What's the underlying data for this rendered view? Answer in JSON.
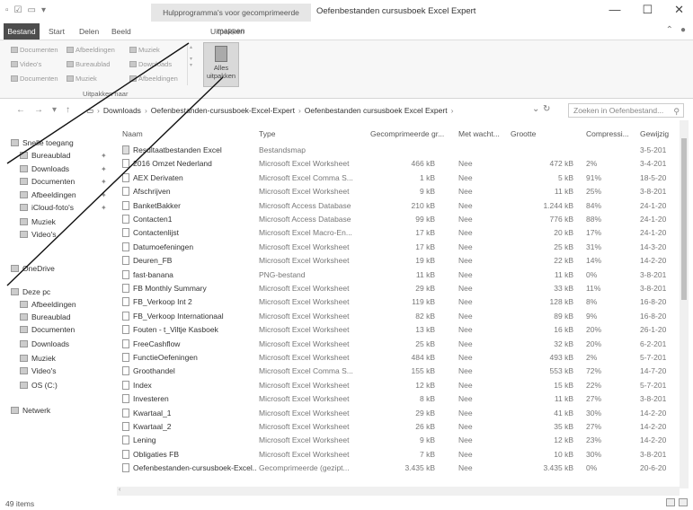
{
  "window": {
    "context_tab": "Hulpprogramma's voor gecomprimeerde mappen",
    "title": "Oefenbestanden cursusboek Excel Expert",
    "minimize": "—",
    "maximize": "☐",
    "close": "✕"
  },
  "ribbon": {
    "tabs": [
      "Bestand",
      "Start",
      "Delen",
      "Beeld",
      "Uitpakken"
    ],
    "gallery": [
      "Documenten",
      "Afbeeldingen",
      "Muziek",
      "Video's",
      "Bureaublad",
      "Downloads",
      "Documenten",
      "Muziek",
      "Afbeeldingen"
    ],
    "extract_all": "Alles uitpakken",
    "group_label": "Uitpakken naar"
  },
  "address": {
    "path": [
      "Downloads",
      "Oefenbestanden-cursusboek-Excel-Expert",
      "Oefenbestanden cursusboek Excel Expert"
    ],
    "search_placeholder": "Zoeken in Oefenbestand..."
  },
  "navpane": [
    {
      "label": "Snelle toegang",
      "icon": "star-icon",
      "pinned": false,
      "indent": 0
    },
    {
      "label": "Bureaublad",
      "icon": "desktop-icon",
      "pinned": true,
      "indent": 1
    },
    {
      "label": "Downloads",
      "icon": "download-icon",
      "pinned": true,
      "indent": 1
    },
    {
      "label": "Documenten",
      "icon": "document-icon",
      "pinned": true,
      "indent": 1
    },
    {
      "label": "Afbeeldingen",
      "icon": "picture-icon",
      "pinned": true,
      "indent": 1
    },
    {
      "label": "iCloud-foto's",
      "icon": "cloud-icon",
      "pinned": true,
      "indent": 1
    },
    {
      "label": "Muziek",
      "icon": "music-icon",
      "pinned": false,
      "indent": 1
    },
    {
      "label": "Video's",
      "icon": "video-icon",
      "pinned": false,
      "indent": 1
    },
    {
      "label": "OneDrive",
      "icon": "onedrive-icon",
      "pinned": false,
      "indent": 0
    },
    {
      "label": "Deze pc",
      "icon": "computer-icon",
      "pinned": false,
      "indent": 0
    },
    {
      "label": "Afbeeldingen",
      "icon": "picture-icon",
      "pinned": false,
      "indent": 1
    },
    {
      "label": "Bureaublad",
      "icon": "desktop-icon",
      "pinned": false,
      "indent": 1
    },
    {
      "label": "Documenten",
      "icon": "document-icon",
      "pinned": false,
      "indent": 1
    },
    {
      "label": "Downloads",
      "icon": "download-icon",
      "pinned": false,
      "indent": 1
    },
    {
      "label": "Muziek",
      "icon": "music-icon",
      "pinned": false,
      "indent": 1
    },
    {
      "label": "Video's",
      "icon": "video-icon",
      "pinned": false,
      "indent": 1
    },
    {
      "label": "OS (C:)",
      "icon": "drive-icon",
      "pinned": false,
      "indent": 1
    },
    {
      "label": "Netwerk",
      "icon": "network-icon",
      "pinned": false,
      "indent": 0
    }
  ],
  "columns": [
    "Naam",
    "Type",
    "Gecomprimeerde gr...",
    "Met wacht...",
    "Grootte",
    "Compressi...",
    "Gewijzig"
  ],
  "files": [
    [
      "Resultaatbestanden Excel",
      "Bestandsmap",
      "",
      "",
      "",
      "",
      "3-5-201"
    ],
    [
      "2016 Omzet Nederland",
      "Microsoft Excel Worksheet",
      "466 kB",
      "Nee",
      "472 kB",
      "2%",
      "3-4-201"
    ],
    [
      "AEX Derivaten",
      "Microsoft Excel Comma S...",
      "1 kB",
      "Nee",
      "5 kB",
      "91%",
      "18-5-20"
    ],
    [
      "Afschrijven",
      "Microsoft Excel Worksheet",
      "9 kB",
      "Nee",
      "11 kB",
      "25%",
      "3-8-201"
    ],
    [
      "BanketBakker",
      "Microsoft Access Database",
      "210 kB",
      "Nee",
      "1.244 kB",
      "84%",
      "24-1-20"
    ],
    [
      "Contacten1",
      "Microsoft Access Database",
      "99 kB",
      "Nee",
      "776 kB",
      "88%",
      "24-1-20"
    ],
    [
      "Contactenlijst",
      "Microsoft Excel Macro-En...",
      "17 kB",
      "Nee",
      "20 kB",
      "17%",
      "24-1-20"
    ],
    [
      "Datumoefeningen",
      "Microsoft Excel Worksheet",
      "17 kB",
      "Nee",
      "25 kB",
      "31%",
      "14-3-20"
    ],
    [
      "Deuren_FB",
      "Microsoft Excel Worksheet",
      "19 kB",
      "Nee",
      "22 kB",
      "14%",
      "14-2-20"
    ],
    [
      "fast-banana",
      "PNG-bestand",
      "11 kB",
      "Nee",
      "11 kB",
      "0%",
      "3-8-201"
    ],
    [
      "FB Monthly Summary",
      "Microsoft Excel Worksheet",
      "29 kB",
      "Nee",
      "33 kB",
      "11%",
      "3-8-201"
    ],
    [
      "FB_Verkoop Int 2",
      "Microsoft Excel Worksheet",
      "119 kB",
      "Nee",
      "128 kB",
      "8%",
      "16-8-20"
    ],
    [
      "FB_Verkoop Internationaal",
      "Microsoft Excel Worksheet",
      "82 kB",
      "Nee",
      "89 kB",
      "9%",
      "16-8-20"
    ],
    [
      "Fouten - t_Viltje Kasboek",
      "Microsoft Excel Worksheet",
      "13 kB",
      "Nee",
      "16 kB",
      "20%",
      "26-1-20"
    ],
    [
      "FreeCashflow",
      "Microsoft Excel Worksheet",
      "25 kB",
      "Nee",
      "32 kB",
      "20%",
      "6-2-201"
    ],
    [
      "FunctieOefeningen",
      "Microsoft Excel Worksheet",
      "484 kB",
      "Nee",
      "493 kB",
      "2%",
      "5-7-201"
    ],
    [
      "Groothandel",
      "Microsoft Excel Comma S...",
      "155 kB",
      "Nee",
      "553 kB",
      "72%",
      "14-7-20"
    ],
    [
      "Index",
      "Microsoft Excel Worksheet",
      "12 kB",
      "Nee",
      "15 kB",
      "22%",
      "5-7-201"
    ],
    [
      "Investeren",
      "Microsoft Excel Worksheet",
      "8 kB",
      "Nee",
      "11 kB",
      "27%",
      "3-8-201"
    ],
    [
      "Kwartaal_1",
      "Microsoft Excel Worksheet",
      "29 kB",
      "Nee",
      "41 kB",
      "30%",
      "14-2-20"
    ],
    [
      "Kwartaal_2",
      "Microsoft Excel Worksheet",
      "26 kB",
      "Nee",
      "35 kB",
      "27%",
      "14-2-20"
    ],
    [
      "Lening",
      "Microsoft Excel Worksheet",
      "9 kB",
      "Nee",
      "12 kB",
      "23%",
      "14-2-20"
    ],
    [
      "Obligaties FB",
      "Microsoft Excel Worksheet",
      "7 kB",
      "Nee",
      "10 kB",
      "30%",
      "3-8-201"
    ],
    [
      "Oefenbestanden-cursusboek-Excel...",
      "Gecomprimeerde (gezipt...",
      "3.435 kB",
      "Nee",
      "3.435 kB",
      "0%",
      "20-6-20"
    ]
  ],
  "status": "49 items"
}
